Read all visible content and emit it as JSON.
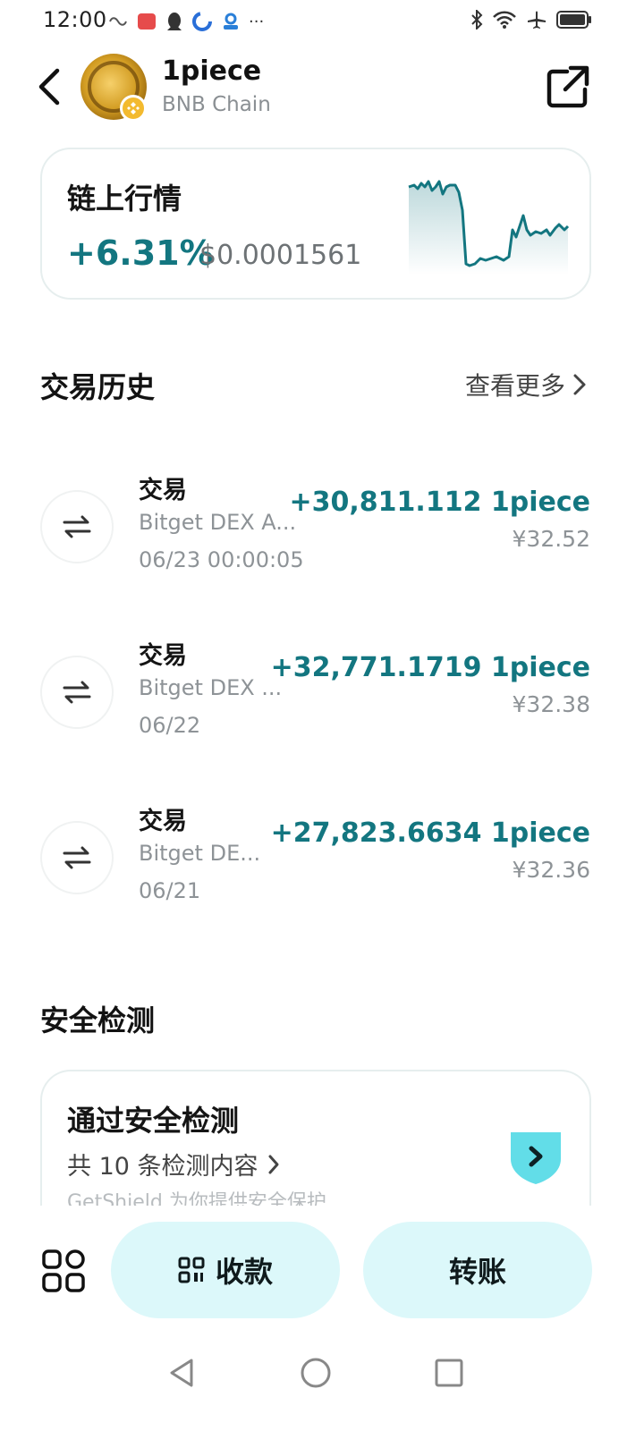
{
  "status_bar": {
    "time": "12:00",
    "left_icons": [
      "link-icon",
      "app-badge-icon",
      "qq-icon",
      "browser-icon",
      "cloud-icon",
      "more-icon"
    ],
    "right_icons": [
      "bluetooth-icon",
      "wifi-icon",
      "airplane-icon",
      "battery-icon"
    ],
    "more_glyph": "···"
  },
  "header": {
    "token_name": "1piece",
    "chain": "BNB Chain"
  },
  "market": {
    "title": "链上行情",
    "change": "+6.31%",
    "price": "$0.0001561",
    "accent": "#137680"
  },
  "history": {
    "title": "交易历史",
    "see_more": "查看更多",
    "items": [
      {
        "type": "交易",
        "source": "Bitget DEX A...",
        "date": "06/23 00:00:05",
        "amount": "+30,811.112 1piece",
        "fiat": "¥32.52"
      },
      {
        "type": "交易",
        "source": "Bitget DEX ...",
        "date": "06/22",
        "amount": "+32,771.1719 1piece",
        "fiat": "¥32.38"
      },
      {
        "type": "交易",
        "source": "Bitget DE...",
        "date": "06/21",
        "amount": "+27,823.6634 1piece",
        "fiat": "¥32.36"
      }
    ]
  },
  "security": {
    "title": "安全检测",
    "card_title": "通过安全检测",
    "card_sub": "共 10 条检测内容",
    "card_foot": "GetShield 为你提供安全保护"
  },
  "bottom": {
    "receive": "收款",
    "transfer": "转账"
  }
}
